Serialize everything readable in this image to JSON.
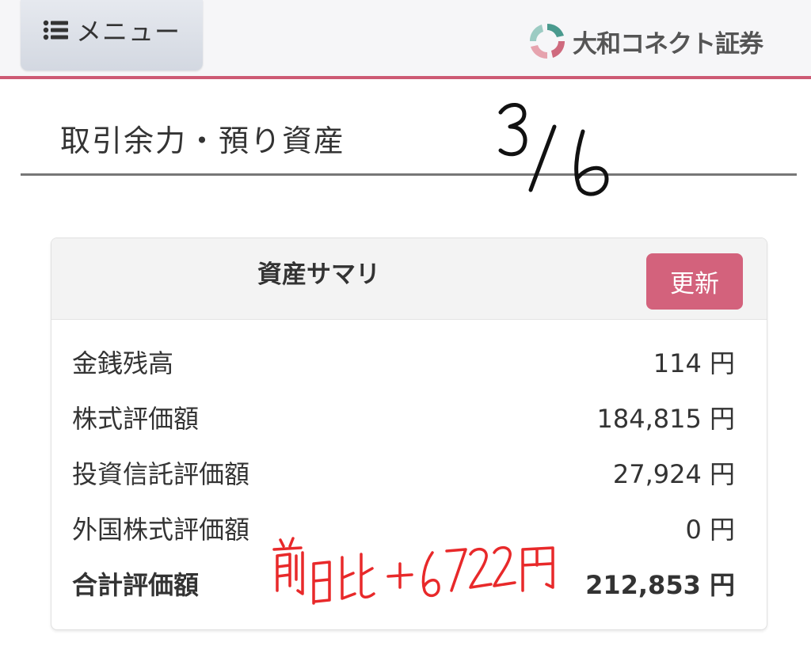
{
  "header": {
    "menu_label": "メニュー",
    "brand_name": "大和コネクト証券",
    "accent_color": "#cd5a74"
  },
  "page": {
    "title": "取引余力・預り資産"
  },
  "summary": {
    "title": "資産サマリ",
    "refresh_label": "更新",
    "rows": [
      {
        "label": "金銭残高",
        "value": "114 円"
      },
      {
        "label": "株式評価額",
        "value": "184,815 円"
      },
      {
        "label": "投資信託評価額",
        "value": "27,924 円"
      },
      {
        "label": "外国株式評価額",
        "value": "0 円"
      }
    ],
    "total": {
      "label": "合計評価額",
      "value": "212,853 円"
    }
  },
  "annotations": {
    "date_note": "3/6",
    "change_note": "前日比＋6722円"
  }
}
